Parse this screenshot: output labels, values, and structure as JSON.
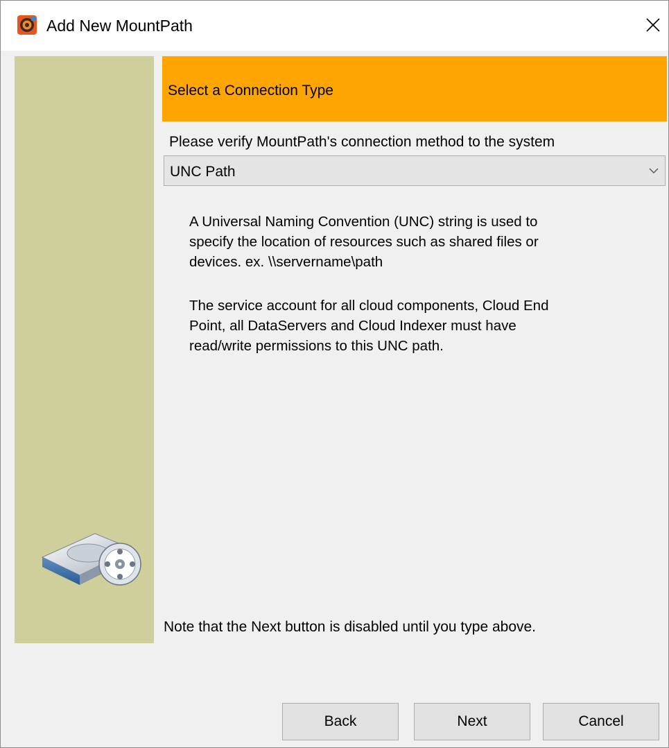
{
  "window": {
    "title": "Add New MountPath"
  },
  "header": {
    "title": "Select a Connection Type",
    "background_color": "#ffa500"
  },
  "sidebar": {
    "background_color": "#cfcf9b",
    "icon": "hard-drive-icon"
  },
  "main": {
    "prompt": "Please verify MountPath's connection method to the system",
    "connection_type": {
      "selected": "UNC Path"
    },
    "description_1": "A Universal Naming Convention (UNC) string is used to\nspecify the location of resources such as shared files or\ndevices. ex. \\\\servername\\path",
    "description_2": "The service account for all cloud components, Cloud End\nPoint, all DataServers and Cloud Indexer must have\nread/write permissions to this UNC path.",
    "note": "Note that the Next button is disabled until you type above."
  },
  "buttons": {
    "back": "Back",
    "next": "Next",
    "cancel": "Cancel"
  }
}
